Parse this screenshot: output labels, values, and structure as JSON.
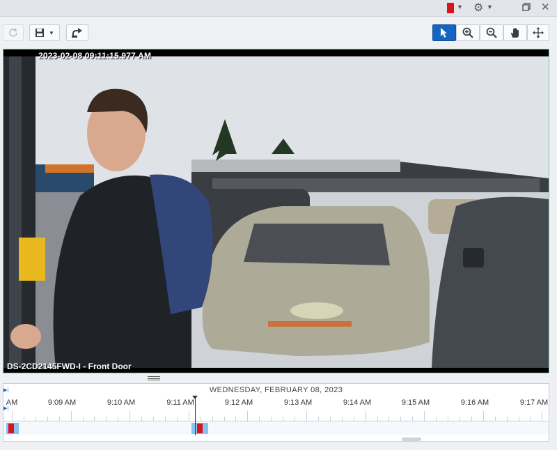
{
  "titlebar": {
    "flag_color": "#d7131e",
    "icons": [
      "red-flag-icon",
      "gear-icon",
      "restore-icon",
      "close-icon"
    ],
    "close_glyph": "✕",
    "gear_glyph": "⚙"
  },
  "toolbar": {
    "left_buttons": [
      "refresh-icon",
      "save-icon",
      "export-icon"
    ],
    "right_buttons": [
      "pointer-icon",
      "zoom-in-icon",
      "zoom-out-icon",
      "pan-hand-icon",
      "move-icon"
    ],
    "active_tool": "pointer",
    "accent": "#1565c0"
  },
  "video": {
    "timestamp": "2023-02-08 09:11:15.977 AM",
    "camera_label": "DS-2CD2145FWD-I - Front Door",
    "border_color": "#6fd3a3"
  },
  "timeline": {
    "date_label": "WEDNESDAY, FEBRUARY 08, 2023",
    "time_labels": [
      "AM",
      "9:09 AM",
      "9:10 AM",
      "9:11 AM",
      "9:12 AM",
      "9:13 AM",
      "9:14 AM",
      "9:15 AM",
      "9:16 AM",
      "9:17 AM"
    ],
    "recording_color": "#87c3ef",
    "event_color": "#d7131e"
  }
}
